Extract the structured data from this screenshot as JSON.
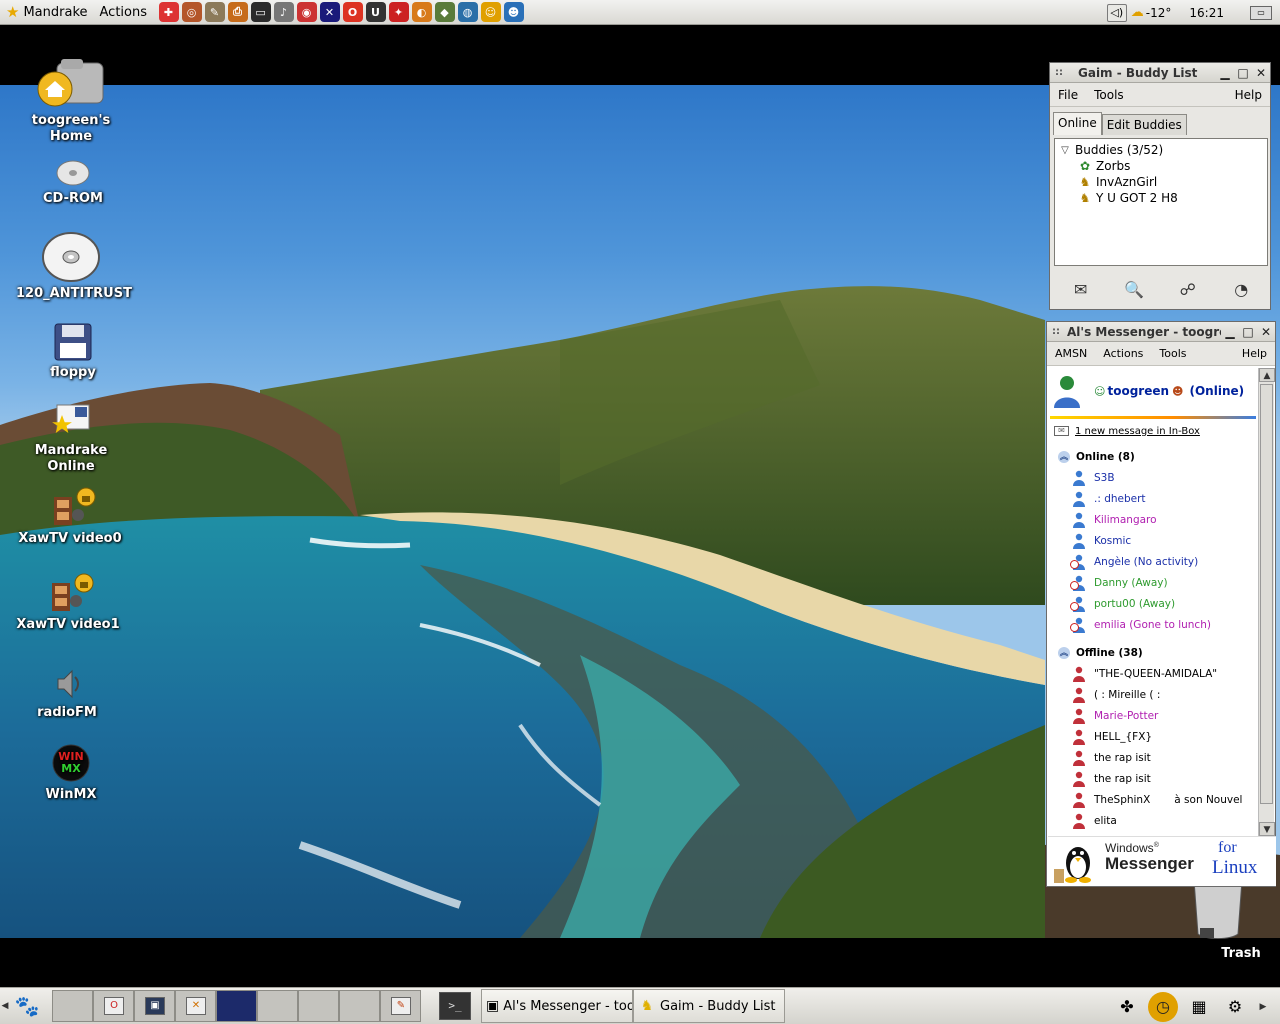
{
  "top_panel": {
    "menu_distro": "Mandrake",
    "menu_actions": "Actions",
    "launchers": [
      "help-icon",
      "kde-icon",
      "gimp-icon",
      "printer-icon",
      "terminal-icon",
      "sound-icon",
      "cd-player-icon",
      "mms-icon",
      "opera-icon",
      "unreal-icon",
      "red-hat-icon",
      "eye-icon",
      "browser-icon",
      "globe-icon",
      "user-icon",
      "user2-icon"
    ],
    "weather": "-12°",
    "clock": "16:21"
  },
  "desktop_icons": [
    {
      "label": "toogreen's Home",
      "icon": "home-folder-icon"
    },
    {
      "label": "CD-ROM",
      "icon": "cdrom-icon"
    },
    {
      "label": "120_ANTITRUST",
      "icon": "cd-disc-icon"
    },
    {
      "label": "floppy",
      "icon": "floppy-icon"
    },
    {
      "label": "Mandrake Online",
      "icon": "mandrake-online-icon"
    },
    {
      "label": "XawTV video0",
      "icon": "tv-video-icon"
    },
    {
      "label": "XawTV video1",
      "icon": "tv-video-icon"
    },
    {
      "label": "radioFM",
      "icon": "speaker-icon"
    },
    {
      "label": "WinMX",
      "icon": "winmx-icon"
    }
  ],
  "trash": {
    "label": "Trash"
  },
  "gaim": {
    "title": "Gaim - Buddy List",
    "menu": {
      "file": "File",
      "tools": "Tools",
      "help": "Help"
    },
    "tabs": {
      "online": "Online",
      "edit": "Edit Buddies"
    },
    "group": "Buddies (3/52)",
    "buddies": [
      "Zorbs",
      "InvAznGirl",
      "Y U GOT 2 H8"
    ]
  },
  "amsn": {
    "title": "Al's Messenger - toogre",
    "menu": {
      "amsn": "AMSN",
      "actions": "Actions",
      "tools": "Tools",
      "help": "Help"
    },
    "me": {
      "name": "toogreen",
      "status": "(Online)"
    },
    "inbox": "1 new message in In-Box",
    "online_group": "Online (8)",
    "offline_group": "Offline (38)",
    "online": [
      {
        "name": "S3B",
        "color": "#1a2fa8",
        "icon": "user-online-icon"
      },
      {
        "name": ".: dhebert",
        "color": "#1a2fa8",
        "icon": "user-online-icon"
      },
      {
        "name": "Kilimangaro",
        "color": "#b01fb0",
        "icon": "user-online-icon"
      },
      {
        "name": "Kosmic",
        "color": "#1a2fa8",
        "icon": "user-online-icon"
      },
      {
        "name": "Angèle (No activity)",
        "color": "#1a2fa8",
        "icon": "user-idle-icon"
      },
      {
        "name": "Danny (Away)",
        "color": "#2f9b2f",
        "icon": "user-away-icon"
      },
      {
        "name": "portu00 (Away)",
        "color": "#2f9b2f",
        "icon": "user-away-icon"
      },
      {
        "name": "emilia (Gone to lunch)",
        "color": "#b01fb0",
        "icon": "user-away-icon"
      }
    ],
    "offline": [
      {
        "name": "\"THE-QUEEN-AMIDALA\"",
        "color": "#000000"
      },
      {
        "name": "( : Mireille ( :",
        "color": "#000000"
      },
      {
        "name": "Marie-Potter",
        "color": "#b01fb0"
      },
      {
        "name": "HELL_{FX}",
        "color": "#000000"
      },
      {
        "name": "the rap isit",
        "color": "#000000"
      },
      {
        "name": "the rap isit",
        "color": "#000000"
      },
      {
        "name": "TheSphinX",
        "suffix": "à son Nouvel",
        "color": "#000000"
      },
      {
        "name": "elita",
        "color": "#000000"
      }
    ],
    "banner": {
      "windows": "Windows",
      "reg": "®",
      "messenger": "Messenger",
      "for": "for",
      "linux": "Linux"
    }
  },
  "bottom_panel": {
    "tasks": [
      {
        "label": "Al's Messenger - toogr",
        "icon": "amsn-icon"
      },
      {
        "label": "Gaim - Buddy List",
        "icon": "gaim-icon"
      }
    ]
  }
}
